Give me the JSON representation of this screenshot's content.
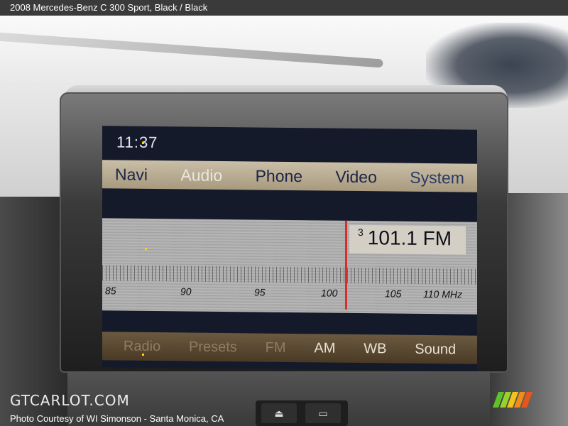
{
  "header": {
    "title": "2008 Mercedes-Benz C 300 Sport,  Black / Black"
  },
  "screen": {
    "clock": "11:37",
    "menu": [
      {
        "label": "Navi"
      },
      {
        "label": "Audio"
      },
      {
        "label": "Phone"
      },
      {
        "label": "Video"
      },
      {
        "label": "System"
      }
    ],
    "tuner": {
      "preset": "3",
      "frequency": "101.1 FM",
      "scale": [
        "85",
        "90",
        "95",
        "100",
        "105",
        "110 MHz"
      ]
    },
    "bottom_menu": [
      {
        "label": "Radio"
      },
      {
        "label": "Presets"
      },
      {
        "label": "FM"
      },
      {
        "label": "AM"
      },
      {
        "label": "WB"
      },
      {
        "label": "Sound"
      }
    ]
  },
  "footer": {
    "watermark": "GTCARLOT.COM",
    "credit": "Photo Courtesy of WI Simonson - Santa Monica, CA"
  },
  "colors": {
    "stripes": [
      "#5fc22a",
      "#9ad12b",
      "#f2c418",
      "#f08c17",
      "#e8561c"
    ]
  }
}
